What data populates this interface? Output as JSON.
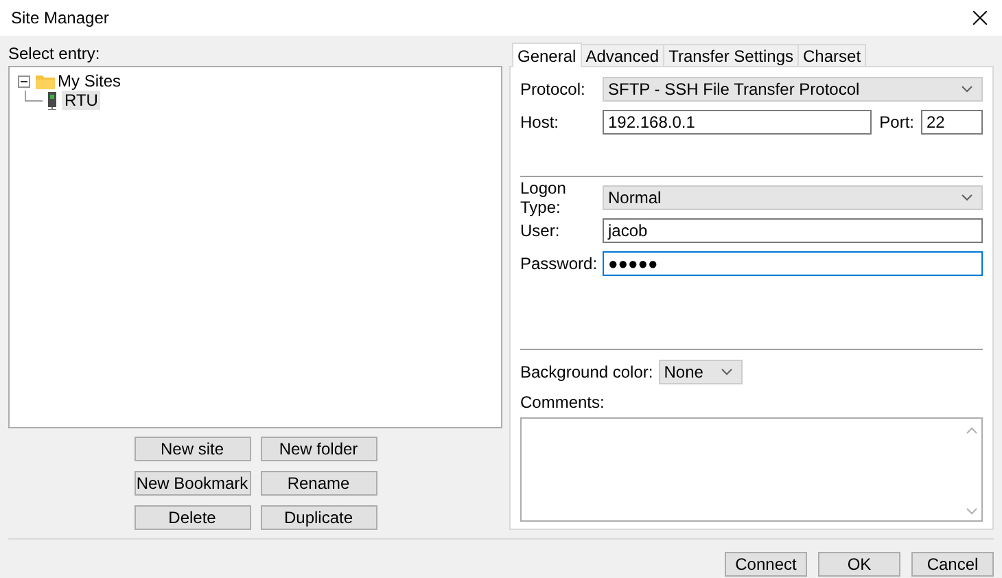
{
  "window": {
    "title": "Site Manager"
  },
  "site_tree": {
    "label": "Select entry:",
    "items": [
      {
        "label": "My Sites",
        "kind": "folder",
        "expanded": true,
        "selected": false,
        "children": [
          {
            "label": "RTU",
            "kind": "site",
            "selected": true
          }
        ]
      }
    ]
  },
  "site_buttons": [
    "New site",
    "New folder",
    "New Bookmark",
    "Rename",
    "Delete",
    "Duplicate"
  ],
  "tabs": [
    {
      "label": "General",
      "selected": true
    },
    {
      "label": "Advanced",
      "selected": false
    },
    {
      "label": "Transfer Settings",
      "selected": false
    },
    {
      "label": "Charset",
      "selected": false
    }
  ],
  "general": {
    "protocol": {
      "label": "Protocol:",
      "value": "SFTP - SSH File Transfer Protocol"
    },
    "host": {
      "label": "Host:",
      "value": "192.168.0.1",
      "focused": false
    },
    "port": {
      "label": "Port:",
      "value": "22",
      "focused": false
    },
    "logon_type": {
      "label": "Logon Type:",
      "value": "Normal"
    },
    "user": {
      "label": "User:",
      "value": "jacob",
      "focused": false
    },
    "password": {
      "label": "Password:",
      "value": "●●●●●",
      "focused": true
    },
    "background_color": {
      "label": "Background color:",
      "value": "None"
    },
    "comments": {
      "label": "Comments:"
    }
  },
  "dialog_buttons": [
    "Connect",
    "OK",
    "Cancel"
  ]
}
